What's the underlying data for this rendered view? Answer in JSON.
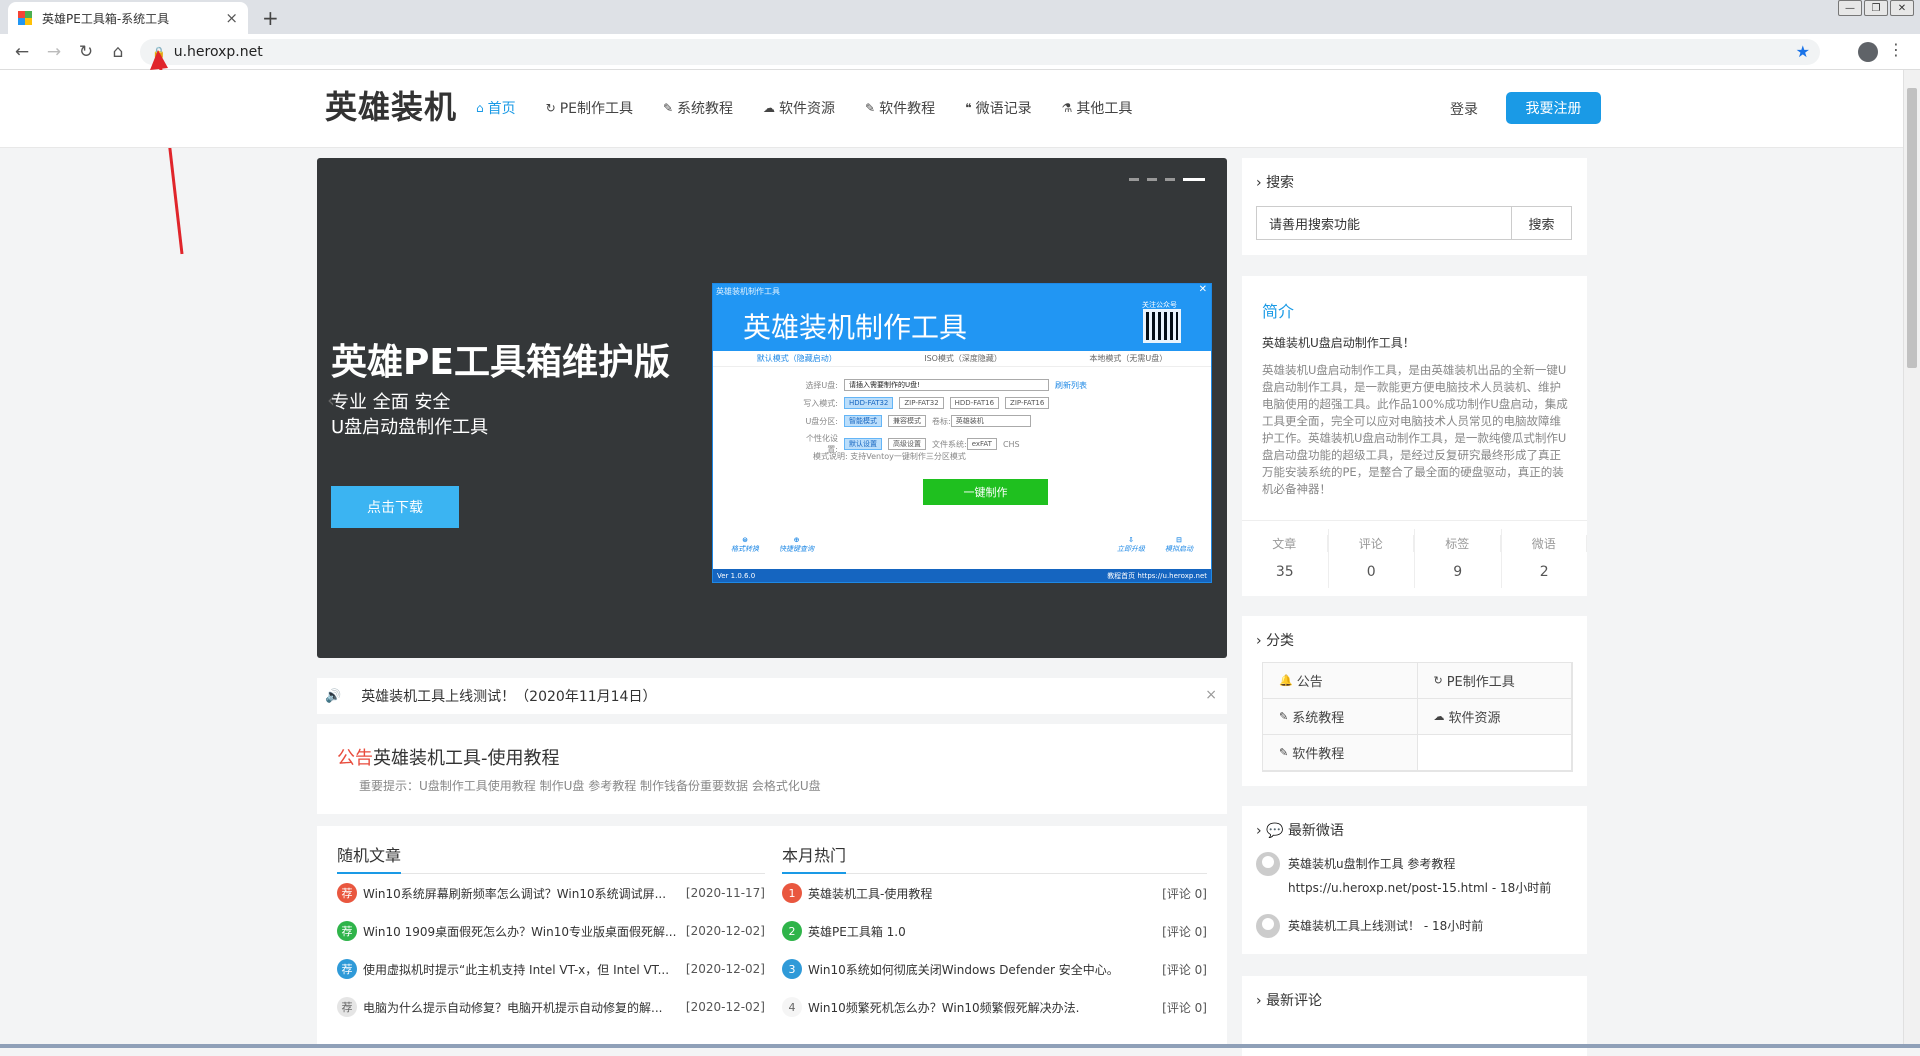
{
  "browser": {
    "tab_title": "英雄PE工具箱-系统工具",
    "url": "u.heroxp.net",
    "new_tab": "+",
    "tab_close": "×"
  },
  "site": {
    "logo": "英雄装机",
    "menu": [
      {
        "label": "首页",
        "icon": "home-icon",
        "active": true
      },
      {
        "label": "PE制作工具",
        "icon": "refresh-icon"
      },
      {
        "label": "系统教程",
        "icon": "brush-icon"
      },
      {
        "label": "软件资源",
        "icon": "cloud-icon"
      },
      {
        "label": "软件教程",
        "icon": "brush-icon"
      },
      {
        "label": "微语记录",
        "icon": "quote-icon"
      },
      {
        "label": "其他工具",
        "icon": "flask-icon"
      }
    ],
    "login": "登录",
    "register": "我要注册"
  },
  "banner": {
    "title": "英雄PE工具箱维护版",
    "sub1": "专业 全面 安全",
    "sub2": "U盘启动盘制作工具",
    "button": "点击下载",
    "shot": {
      "caption": "英雄装机制作工具",
      "title": "英雄装机制作工具",
      "qr_caption": "关注公众号",
      "modes": [
        "默认模式（隐藏启动）",
        "ISO模式（深度隐藏）",
        "本地模式（无需U盘）"
      ],
      "row1_label": "选择U盘:",
      "row1_value": "请插入需要制作的U盘!",
      "refresh": "刷新列表",
      "row2_label": "写入模式:",
      "row2_opts": [
        "HDD-FAT32",
        "ZIP-FAT32",
        "HDD-FAT16",
        "ZIP-FAT16"
      ],
      "row3_label": "U盘分区:",
      "row3_opts": [
        "智能模式",
        "兼容模式"
      ],
      "row3_vol_label": "卷标:",
      "row3_vol": "英雄装机",
      "row4_label": "个性化设置:",
      "row4_opts": [
        "默认设置",
        "高级设置"
      ],
      "row4_fs_label": "文件系统:",
      "row4_fs": "exFAT",
      "row4_chs": "CHS",
      "row5": "模式说明: 支持Ventoy一键制作三分区模式",
      "go": "一键制作",
      "bottom": [
        "格式转换",
        "快捷键查询",
        "立即升级",
        "模拟启动"
      ],
      "status_left": "Ver 1.0.6.0",
      "status_right": "教程首页 https://u.heroxp.net"
    }
  },
  "notice": {
    "text": "英雄装机工具上线测试！（2020年11月14日）",
    "close": "×"
  },
  "post": {
    "tag": "公告",
    "title": "英雄装机工具-使用教程",
    "desc": "重要提示：U盘制作工具使用教程 制作U盘 参考教程 制作钱备份重要数据 会格式化U盘"
  },
  "random": {
    "heading": "随机文章",
    "items": [
      {
        "badge": "荐",
        "color": "#e9573f",
        "text": "Win10系统屏幕刷新频率怎么调试？Win10系统调试屏...",
        "date": "[2020-11-17]"
      },
      {
        "badge": "荐",
        "color": "#2fb44a",
        "text": "Win10 1909桌面假死怎么办？Win10专业版桌面假死解...",
        "date": "[2020-12-02]"
      },
      {
        "badge": "荐",
        "color": "#2f9ad8",
        "text": "使用虚拟机时提示“此主机支持 Intel VT-x，但 Intel VT...",
        "date": "[2020-12-02]"
      },
      {
        "badge": "荐",
        "color": "#e5e5e5",
        "text": "电脑为什么提示自动修复？电脑开机提示自动修复的解...",
        "date": "[2020-12-02]"
      }
    ]
  },
  "hot": {
    "heading": "本月热门",
    "items": [
      {
        "badge": "1",
        "color": "#e9573f",
        "text": "英雄装机工具-使用教程",
        "date": "[评论 0]"
      },
      {
        "badge": "2",
        "color": "#2fb44a",
        "text": "英雄PE工具箱 1.0",
        "date": "[评论 0]"
      },
      {
        "badge": "3",
        "color": "#2f9ad8",
        "text": "Win10系统如何彻底关闭Windows Defender 安全中心。",
        "date": "[评论 0]"
      },
      {
        "badge": "4",
        "color": "#f5f5f5",
        "text": "Win10频繁死机怎么办？Win10频繁假死解决办法.",
        "date": "[评论 0]"
      }
    ]
  },
  "sidebar": {
    "search": {
      "heading": "搜索",
      "placeholder": "请善用搜索功能",
      "button": "搜索"
    },
    "intro": {
      "heading": "简介",
      "sub": "英雄装机U盘启动制作工具！",
      "body": "英雄装机U盘启动制作工具，是由英雄装机出品的全新一键U盘启动制作工具，是一款能更方便电脑技术人员装机、维护电脑使用的超强工具。此作品100%成功制作U盘启动，集成工具更全面，完全可以应对电脑技术人员常见的电脑故障维护工作。英雄装机U盘启动制作工具，是一款纯傻瓜式制作U盘启动盘功能的超级工具，是经过反复研究最终形成了真正万能安装系统的PE，是整合了最全面的硬盘驱动，真正的装机必备神器！",
      "stats": [
        {
          "k": "文章",
          "v": "35"
        },
        {
          "k": "评论",
          "v": "0"
        },
        {
          "k": "标签",
          "v": "9"
        },
        {
          "k": "微语",
          "v": "2"
        }
      ]
    },
    "category": {
      "heading": "分类",
      "items": [
        "公告",
        "PE制作工具",
        "系统教程",
        "软件资源",
        "软件教程"
      ]
    },
    "weibo": {
      "heading": "最新微语",
      "items": [
        {
          "line1": "英雄装机u盘制作工具 参考教程",
          "line2": "https://u.heroxp.net/post-15.html - 18小时前"
        },
        {
          "line1": "英雄装机工具上线测试！ - 18小时前",
          "line2": ""
        }
      ]
    },
    "comment": {
      "heading": "最新评论"
    }
  }
}
